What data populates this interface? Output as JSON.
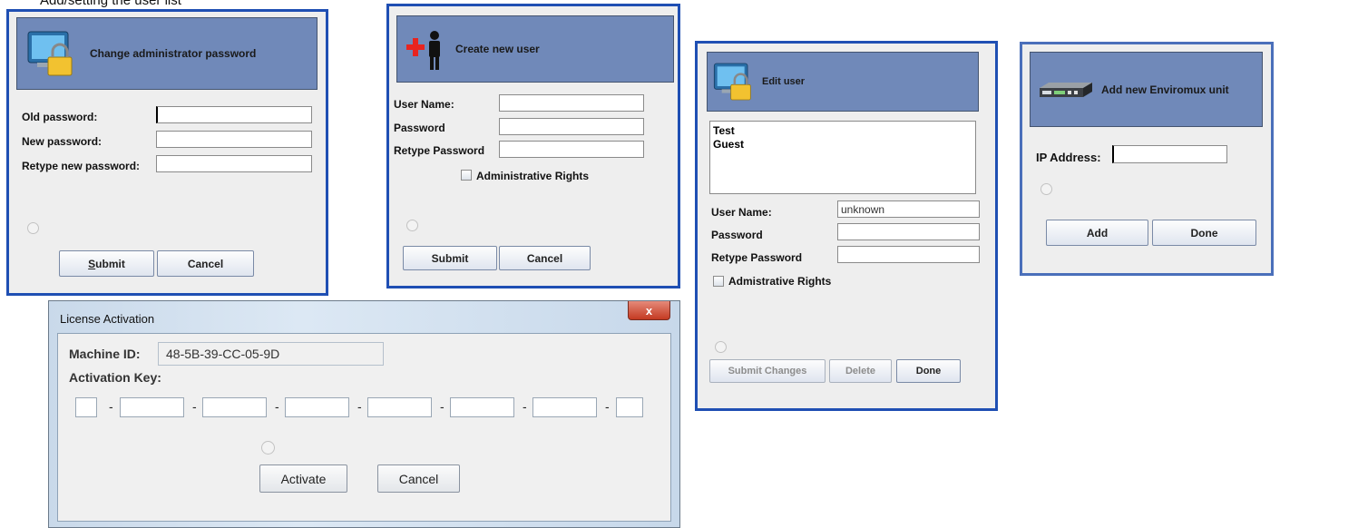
{
  "caption": "Add/setting the user list",
  "change_password": {
    "title": "Change administrator password",
    "old_label": "Old password:",
    "new_label": "New password:",
    "retype_label": "Retype new password:",
    "submit_label": "ubmit",
    "submit_mnemonic": "S",
    "cancel_label": "Cancel"
  },
  "create_user": {
    "title": "Create new user",
    "username_label": "User Name:",
    "password_label": "Password",
    "retype_label": "Retype Password",
    "admin_label": "Administrative Rights",
    "submit_label": "Submit",
    "cancel_label": "Cancel"
  },
  "edit_user": {
    "title": "Edit user",
    "users": [
      "Test",
      "Guest"
    ],
    "username_label": "User Name:",
    "username_value": "unknown",
    "password_label": "Password",
    "retype_label": "Retype Password",
    "admin_label": "Admistrative Rights",
    "submit_label": "Submit Changes",
    "delete_label": "Delete",
    "done_label": "Done"
  },
  "add_unit": {
    "title": "Add new Enviromux unit",
    "ip_label": "IP Address:",
    "add_label": "Add",
    "done_label": "Done"
  },
  "license": {
    "title": "License Activation",
    "close_glyph": "x",
    "machine_id_label": "Machine ID:",
    "machine_id_value": "48-5B-39-CC-05-9D",
    "activation_key_label": "Activation Key:",
    "separator": "-",
    "activate_label": "Activate",
    "cancel_label": "Cancel"
  },
  "colors": {
    "dialog_border": "#1f4fb3",
    "header_bg": "#7089b9",
    "dialog_bg": "#eeeeee"
  },
  "icons": [
    "monitor-lock-icon",
    "add-user-icon",
    "network-device-icon",
    "close-icon"
  ]
}
